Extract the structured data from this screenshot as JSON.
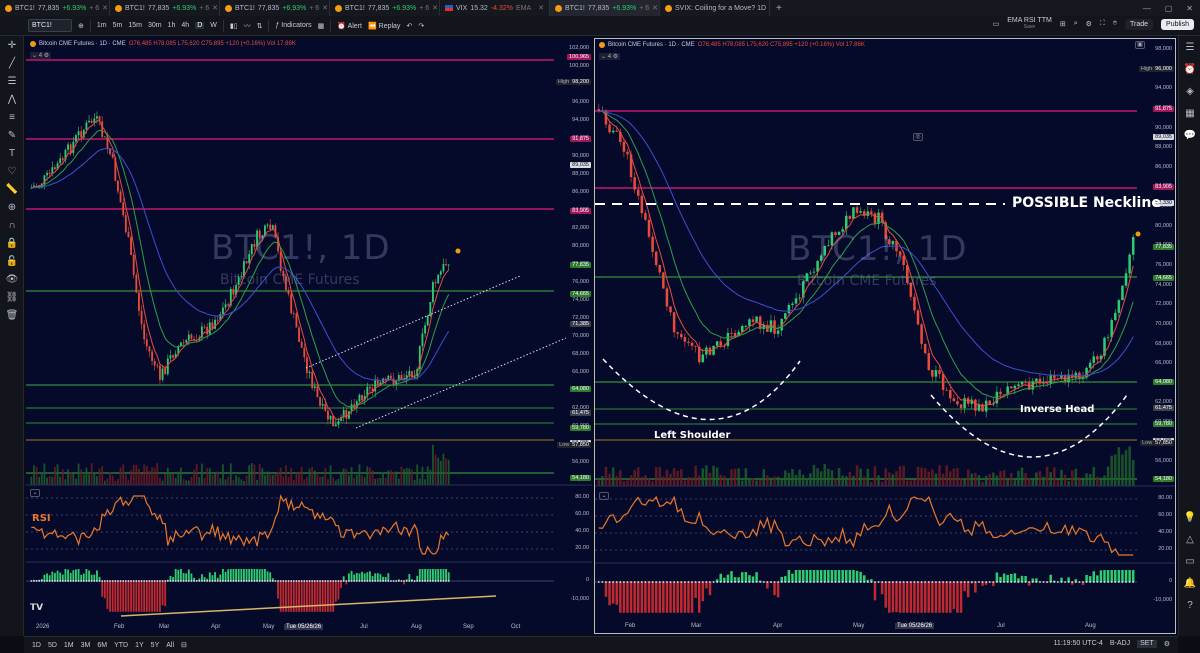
{
  "tabs": [
    {
      "symbol": "BTC1!",
      "price": "77,835",
      "change": "+6.93%",
      "extra": "+ 6",
      "icon": "dot",
      "active": false
    },
    {
      "symbol": "BTC1!",
      "price": "77,835",
      "change": "+6.93%",
      "extra": "+ 6",
      "icon": "dot",
      "active": false
    },
    {
      "symbol": "BTC1!",
      "price": "77,835",
      "change": "+6.93%",
      "extra": "+ 6",
      "icon": "dot",
      "active": false
    },
    {
      "symbol": "BTC1!",
      "price": "77,835",
      "change": "+6.93%",
      "extra": "+ 6",
      "icon": "dot",
      "active": false
    },
    {
      "symbol": "VIX",
      "price": "15.32",
      "change": "-4.32%",
      "extra": "EMA",
      "icon": "flag",
      "active": false
    },
    {
      "symbol": "BTC1!",
      "price": "77,835",
      "change": "+6.93%",
      "extra": "+ 6",
      "icon": "dot",
      "active": true
    },
    {
      "symbol": "SVIX: Coiling for a Move? 1D",
      "price": "",
      "change": "",
      "extra": "",
      "icon": "dot",
      "active": false
    }
  ],
  "toolbar": {
    "symbol": "BTC1!",
    "intervals": [
      "1m",
      "5m",
      "15m",
      "30m",
      "1h",
      "4h",
      "D",
      "W"
    ],
    "selected_interval": "D",
    "indicators": "Indicators",
    "alert": "Alert",
    "replay": "Replay",
    "layout_name": "EMA RSI TTM",
    "layout_sub": "Save",
    "trade": "Trade",
    "publish": "Publish"
  },
  "left_chart": {
    "legend_title": "Bitcoin CME Futures · 1D · CME",
    "legend_ohlc": "O76,485 H78,085 L75,620 C75,895 +120 (+0.16%) Vol 17.86K",
    "legend_count": "4",
    "watermark": "BTC1!, 1D",
    "watermark_sub": "Bitcoin CME Futures",
    "rsi_label": "RSI",
    "price_ticks": [
      "102,000",
      "100,000",
      "98,000",
      "96,000",
      "94,000",
      "92,000",
      "90,000",
      "88,000",
      "86,000",
      "84,000",
      "82,000",
      "80,000",
      "78,000",
      "76,000",
      "74,000",
      "72,000",
      "70,000",
      "68,000",
      "66,000",
      "64,000",
      "62,000",
      "60,000",
      "58,000",
      "56,000",
      "54,000"
    ],
    "price_labels": [
      {
        "text": "100,965",
        "style": "pink"
      },
      {
        "text": "98,200",
        "style": "dk",
        "prefix": "High"
      },
      {
        "text": "91,875",
        "style": "pink"
      },
      {
        "text": "89,035",
        "style": "white"
      },
      {
        "text": "83,905",
        "style": "pink"
      },
      {
        "text": "77,835",
        "style": "green"
      },
      {
        "text": "74,665",
        "style": "green"
      },
      {
        "text": "71,385",
        "style": "gray"
      },
      {
        "text": "64,080",
        "style": "green"
      },
      {
        "text": "61,475",
        "style": "gray"
      },
      {
        "text": "59,780",
        "style": "green"
      },
      {
        "text": "58,085",
        "style": "white"
      },
      {
        "text": "57,850",
        "style": "dk",
        "prefix": "Low"
      },
      {
        "text": "54,180",
        "style": "green"
      }
    ],
    "rsi_ticks": [
      "80.00",
      "60.00",
      "40.00",
      "20.00"
    ],
    "osc_ticks": [
      "0",
      "-10,000"
    ],
    "time_labels": [
      "2026",
      "Feb",
      "Mar",
      "Apr",
      "May",
      "Tue 05/26/26",
      "Jul",
      "Aug",
      "Sep",
      "Oct"
    ]
  },
  "right_chart": {
    "legend_title": "Bitcoin CME Futures · 1D · CME",
    "legend_ohlc": "O76,485 H78,085 L75,620 C75,895 +120 (+0.16%) Vol 17.86K",
    "legend_count": "4",
    "watermark": "BTC1!, 1D",
    "watermark_sub": "Bitcoin CME Futures",
    "price_ticks": [
      "98,000",
      "96,000",
      "94,000",
      "92,000",
      "90,000",
      "88,000",
      "86,000",
      "84,000",
      "82,000",
      "80,000",
      "78,000",
      "76,000",
      "74,000",
      "72,000",
      "70,000",
      "68,000",
      "66,000",
      "64,000",
      "62,000",
      "60,000",
      "58,000",
      "56,000",
      "54,000"
    ],
    "price_labels": [
      {
        "text": "96,000",
        "style": "dk",
        "prefix": "High"
      },
      {
        "text": "91,875",
        "style": "pink"
      },
      {
        "text": "89,035",
        "style": "white"
      },
      {
        "text": "83,905",
        "style": "pink"
      },
      {
        "text": "82,330",
        "style": "white"
      },
      {
        "text": "77,835",
        "style": "green"
      },
      {
        "text": "74,665",
        "style": "green"
      },
      {
        "text": "64,080",
        "style": "green"
      },
      {
        "text": "61,475",
        "style": "gray"
      },
      {
        "text": "59,780",
        "style": "green"
      },
      {
        "text": "58,085",
        "style": "white"
      },
      {
        "text": "57,850",
        "style": "dk",
        "prefix": "Low"
      },
      {
        "text": "54,180",
        "style": "green"
      }
    ],
    "annotations": {
      "neckline": "POSSIBLE Neckline",
      "left_shoulder": "Left Shoulder",
      "inverse_head": "Inverse Head"
    },
    "rsi_ticks": [
      "80.00",
      "60.00",
      "40.00",
      "20.00"
    ],
    "osc_ticks": [
      "0",
      "-10,000"
    ],
    "time_labels": [
      "Feb",
      "Mar",
      "Apr",
      "May",
      "Tue 05/26/26",
      "Jul",
      "Aug"
    ]
  },
  "bottom": {
    "ranges": [
      "1D",
      "5D",
      "1M",
      "3M",
      "6M",
      "YTD",
      "1Y",
      "5Y",
      "All"
    ],
    "clock": "11:19:50 UTC-4",
    "badj": "B-ADJ",
    "set": "SET"
  },
  "colors": {
    "bg": "#060a2a",
    "up": "#2ecc71",
    "down": "#e74c3c",
    "ema_fast": "#e74c3c",
    "ema_mid": "#2e9e4a",
    "ema_slow": "#3d4fd0",
    "rsi": "#e8782a",
    "support": "#2f8f3a",
    "resistance": "#c0186a"
  }
}
